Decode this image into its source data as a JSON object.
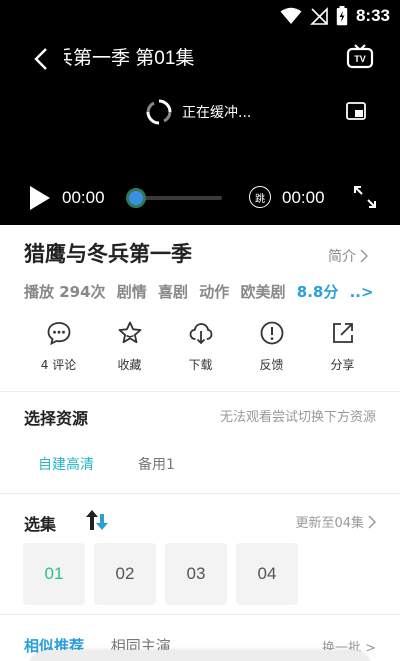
{
  "status_bar": {
    "time": "8:33",
    "icons": [
      "wifi-icon",
      "no-signal-icon",
      "battery-charging-icon"
    ]
  },
  "player": {
    "episode_title": "兵第一季  第01集",
    "buffering_text": "正在缓冲...",
    "current_time": "00:00",
    "duration": "00:00",
    "skip_label": "跳",
    "progress": 0,
    "icons": [
      "back-icon",
      "tv-cast-icon",
      "pip-icon",
      "loading-spinner-icon",
      "play-icon",
      "skip-intro-icon",
      "fullscreen-icon"
    ]
  },
  "show": {
    "title": "猎鹰与冬兵第一季",
    "intro_label": "简介",
    "plays": "播放 294次",
    "genres": [
      "剧情",
      "喜剧",
      "动作",
      "欧美剧"
    ],
    "score": "8.8分",
    "more": "..>"
  },
  "actions": [
    {
      "label": "4 评论",
      "icon": "comment-icon"
    },
    {
      "label": "收藏",
      "icon": "star-icon"
    },
    {
      "label": "下载",
      "icon": "cloud-download-icon"
    },
    {
      "label": "反馈",
      "icon": "feedback-icon"
    },
    {
      "label": "分享",
      "icon": "share-icon"
    }
  ],
  "sources": {
    "title": "选择资源",
    "hint": "无法观看尝试切换下方资源",
    "tabs": [
      "自建高清",
      "备用1"
    ],
    "active_index": 0
  },
  "episodes": {
    "title": "选集",
    "update_text": "更新至04集",
    "items": [
      "01",
      "02",
      "03",
      "04"
    ],
    "active_index": 0
  },
  "bottom": {
    "tab1": "相似推荐",
    "tab2": "相同主演",
    "refresh": "换一批 >"
  },
  "colors": {
    "accent": "#27b6c6",
    "score": "#2aa0d8",
    "episode_active": "#27c08a"
  }
}
